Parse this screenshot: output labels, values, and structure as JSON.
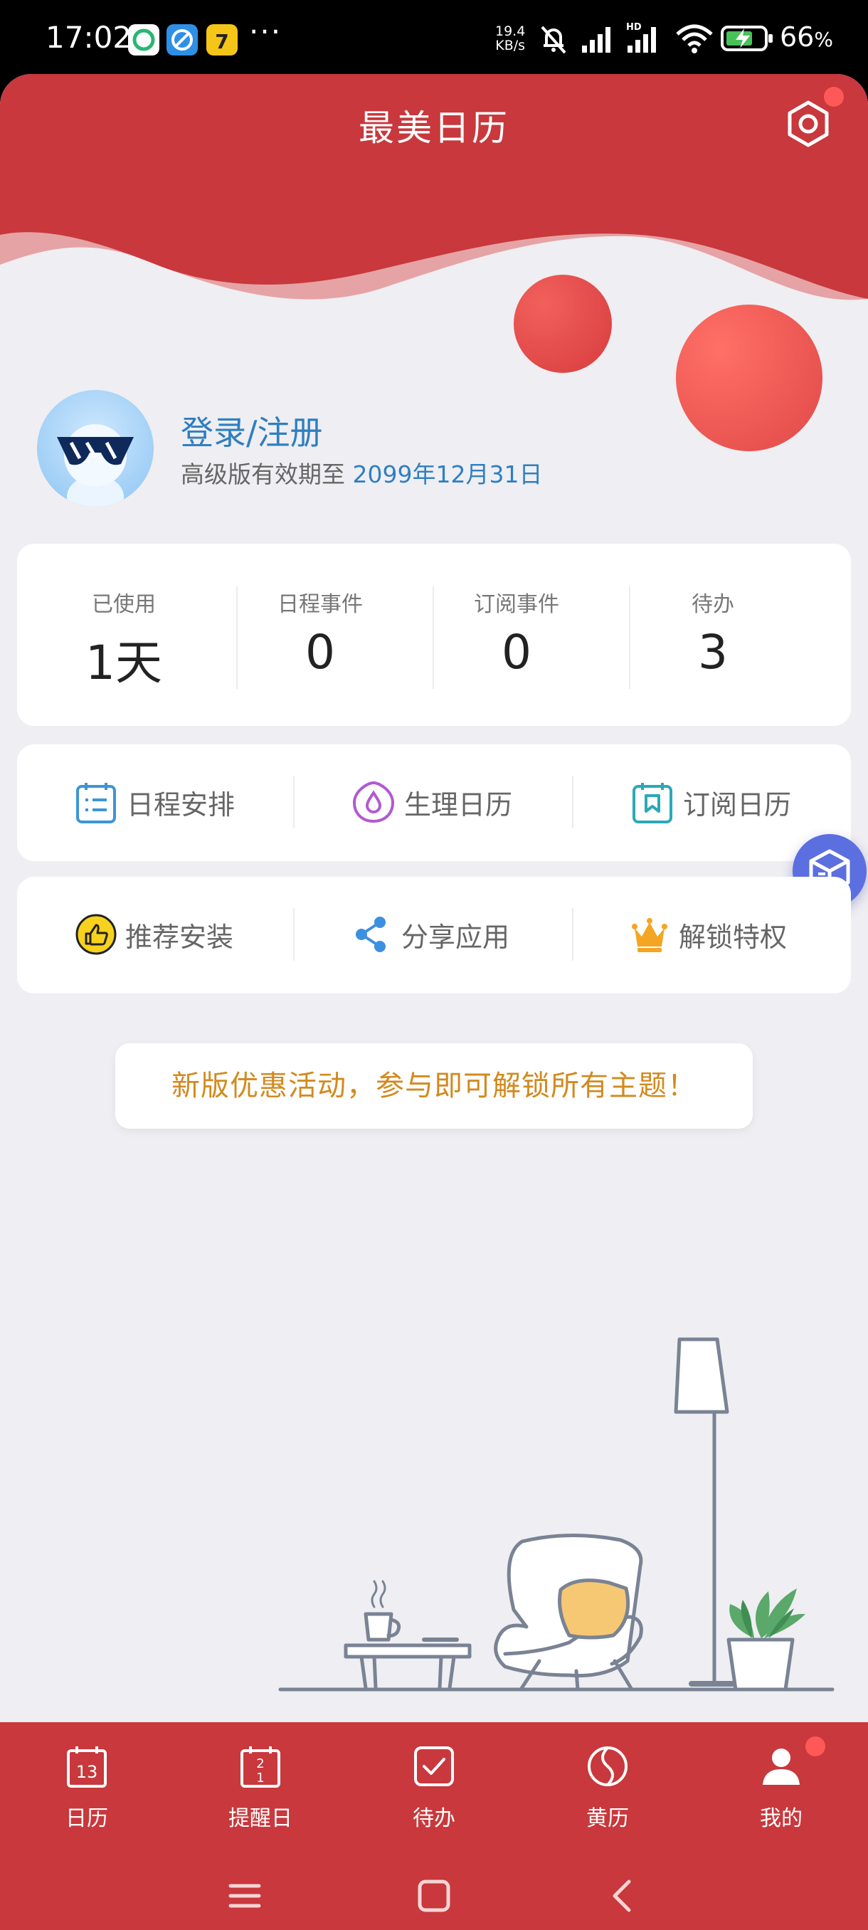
{
  "status_bar": {
    "time": "17:02",
    "more": "···",
    "network_speed_value": "19.4",
    "network_speed_unit": "KB/s",
    "battery": "66",
    "battery_unit": "%",
    "icons": [
      "wechat-like-app-icon",
      "browser-app-icon",
      "reading-app-icon",
      "speed-indicator",
      "mute-icon",
      "signal-icon",
      "hd-signal-icon",
      "wifi-icon",
      "battery-charging-icon"
    ]
  },
  "header": {
    "title": "最美日历",
    "settings_icon": "settings-gear-icon",
    "accent": "#c8383c"
  },
  "profile": {
    "login_text": "登录/注册",
    "vip_label": "高级版有效期至",
    "vip_date": "2099年12月31日"
  },
  "stats": [
    {
      "label": "已使用",
      "value": "1天"
    },
    {
      "label": "日程事件",
      "value": "0"
    },
    {
      "label": "订阅事件",
      "value": "0"
    },
    {
      "label": "待办",
      "value": "3"
    }
  ],
  "menu_row_1": [
    {
      "label": "日程安排",
      "icon": "schedule-icon"
    },
    {
      "label": "生理日历",
      "icon": "drop-icon"
    },
    {
      "label": "订阅日历",
      "icon": "subscribe-calendar-icon"
    }
  ],
  "menu_row_2": [
    {
      "label": "推荐安装",
      "icon": "thumbs-up-icon"
    },
    {
      "label": "分享应用",
      "icon": "share-icon"
    },
    {
      "label": "解锁特权",
      "icon": "crown-icon"
    }
  ],
  "promo": {
    "text": "新版优惠活动，参与即可解锁所有主题！"
  },
  "bottom_nav": [
    {
      "label": "日历",
      "icon": "calendar-icon",
      "icon_text": "13"
    },
    {
      "label": "提醒日",
      "icon": "reminder-icon",
      "icon_text_top": "2",
      "icon_text_bottom": "1"
    },
    {
      "label": "待办",
      "icon": "todo-check-icon"
    },
    {
      "label": "黄历",
      "icon": "almanac-icon"
    },
    {
      "label": "我的",
      "icon": "user-icon",
      "active": true
    }
  ],
  "system_nav": [
    "menu-icon",
    "home-icon",
    "back-icon"
  ]
}
